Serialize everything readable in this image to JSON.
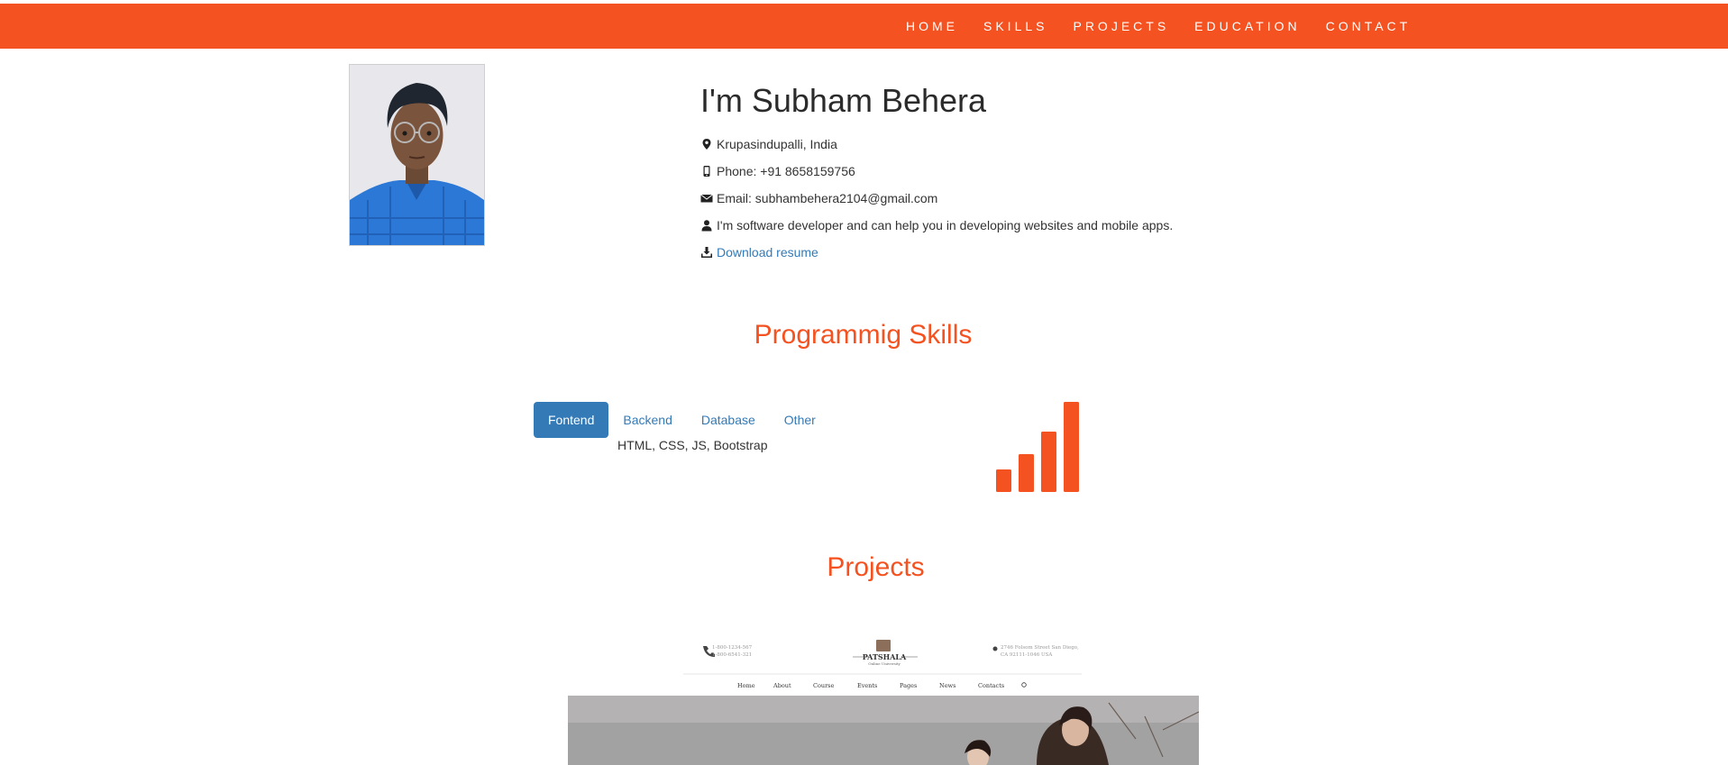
{
  "nav": {
    "items": [
      "HOME",
      "SKILLS",
      "PROJECTS",
      "EDUCATION",
      "CONTACT"
    ]
  },
  "colors": {
    "accent": "#f55221",
    "link": "#337ab7"
  },
  "profile": {
    "heading": "I'm Subham Behera",
    "location": "Krupasindupalli, India",
    "phone": "Phone: +91 8658159756",
    "email": "Email: subhambehera2104@gmail.com",
    "bio": "I'm software developer and can help you in developing websites and mobile apps.",
    "download_label": "Download resume",
    "icons": [
      "map-marker-icon",
      "phone-icon",
      "envelope-icon",
      "user-icon",
      "download-icon"
    ]
  },
  "skills": {
    "title": "Programmig Skills",
    "tabs": [
      "Fontend",
      "Backend",
      "Database",
      "Other"
    ],
    "active_tab": "Fontend",
    "content": "HTML, CSS, JS, Bootstrap",
    "level_bars": 4
  },
  "projects": {
    "title": "Projects",
    "preview": {
      "top_left_lines": [
        "1-800-1234-567",
        "1-800-6541-321"
      ],
      "logo": "PATSHALA",
      "logo_sub": "Online University",
      "top_right_lines": [
        "2746 Folsom Street San Diego,",
        "CA 92111-1046 USA"
      ],
      "menu": [
        "Home",
        "About",
        "Course",
        "Events",
        "Pages",
        "News",
        "Contacts"
      ]
    }
  }
}
